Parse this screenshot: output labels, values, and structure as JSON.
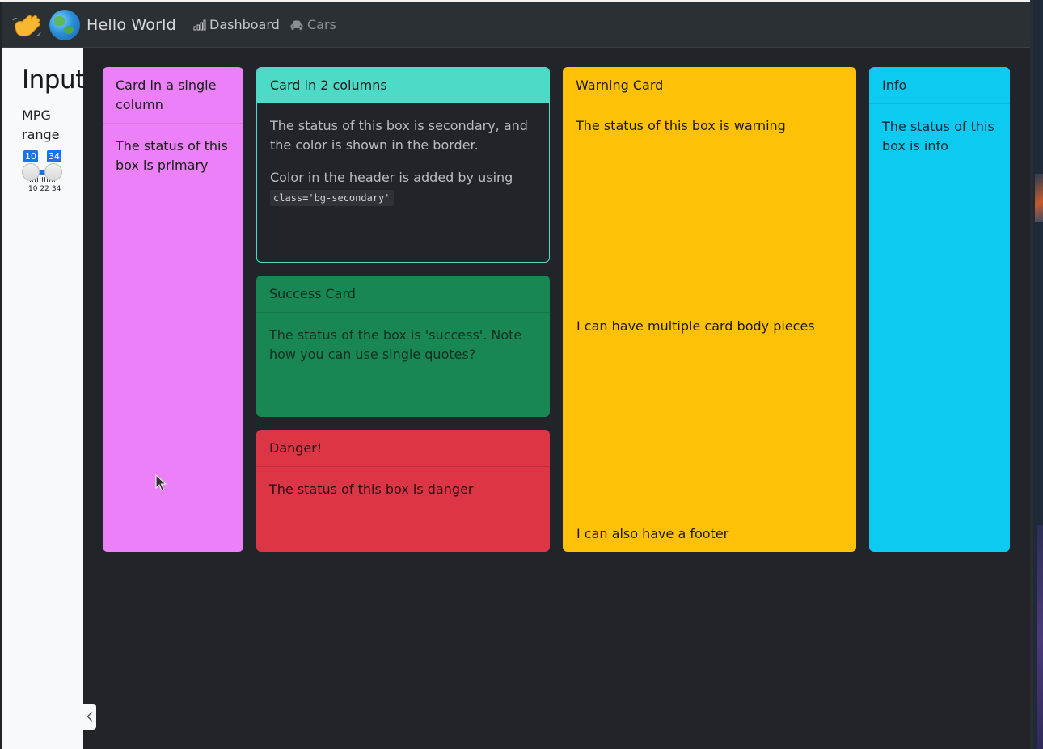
{
  "navbar": {
    "brand_title": "Hello World",
    "links": [
      {
        "label": "Dashboard",
        "icon": "bar-chart-icon"
      },
      {
        "label": "Cars",
        "icon": "car-icon"
      }
    ]
  },
  "sidebar": {
    "title": "Inputs",
    "range_label": "MPG range",
    "slider": {
      "min_value": "10",
      "max_value": "34",
      "ticks": [
        "10",
        "22",
        "34"
      ],
      "accent": "#1a73e8"
    }
  },
  "cards": {
    "primary": {
      "header": "Card in a single column",
      "body": "The status of this box is primary",
      "color": "#ec80f8"
    },
    "secondary": {
      "header": "Card in 2 columns",
      "body1": "The status of this box is secondary, and the color is shown in the border.",
      "body2": "Color in the header is added by using",
      "code": "class='bg-secondary'",
      "color": "#4ddbc8"
    },
    "success": {
      "header": "Success Card",
      "body": "The status of the box is 'success'. Note how you can use single quotes?",
      "color": "#198754"
    },
    "danger": {
      "header": "Danger!",
      "body": "The status of this box is danger",
      "color": "#dc3545"
    },
    "warning": {
      "header": "Warning Card",
      "body1": "The status of this box is warning",
      "body2": "I can have multiple card body pieces",
      "footer": "I can also have a footer",
      "color": "#ffc107"
    },
    "info": {
      "header": "Info",
      "body": "The status of this box is info",
      "color": "#0dcaf0"
    }
  }
}
